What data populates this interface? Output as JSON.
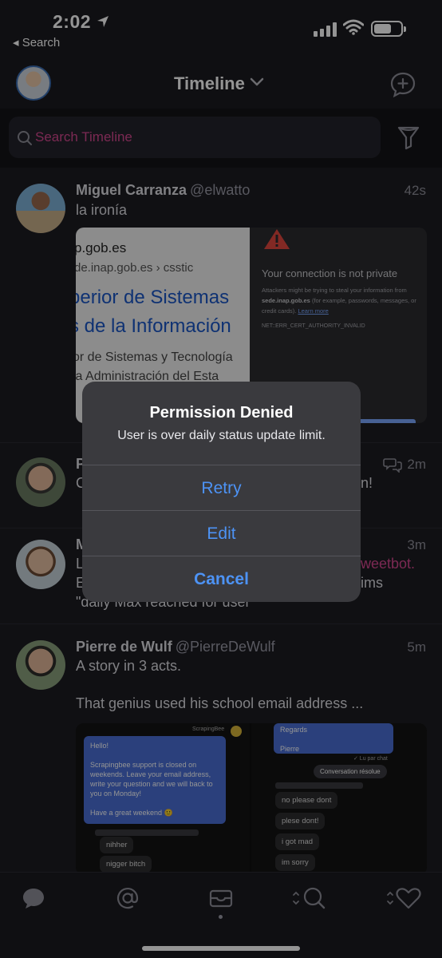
{
  "status_bar": {
    "time": "2:02",
    "back_label": "◂ Search",
    "battery_level": 0.65
  },
  "nav": {
    "title": "Timeline"
  },
  "search": {
    "placeholder": "Search Timeline"
  },
  "colors": {
    "accent_pink": "#d5488f",
    "alert_blue": "#4d93f5",
    "background": "#1c1c22"
  },
  "tweets": [
    {
      "name": "Miguel Carranza",
      "handle": "@elwatto",
      "time": "42s",
      "text": "la ironía",
      "media": {
        "left": {
          "line1": "p.gob.es",
          "line2": "de.inap.gob.es › csstic",
          "line3": "perior de Sistemas",
          "line4": "s de la Información",
          "line5": "or de Sistemas y Tecnología",
          "line6": "la Administración del Esta"
        },
        "right": {
          "title": "Your connection is not private",
          "body_prefix": "Attackers might be trying to steal your information from",
          "body_host": "sede.inap.gob.es",
          "body_suffix": "(for example, passwords, messages, or credit cards).",
          "learn_more": "Learn more",
          "error_code": "NET::ERR_CERT_AUTHORITY_INVALID"
        }
      }
    },
    {
      "name": "P",
      "handle": "",
      "time": "2m",
      "text_start": "C",
      "text_end": "n!"
    },
    {
      "name": "M",
      "handle": "",
      "time": "3m",
      "line1_start": "L",
      "line1_highlight": "weetbot.",
      "line2_start": "E",
      "line2_end": "ims",
      "line3": "\"daily Max reached for user\""
    },
    {
      "name": "Pierre de Wulf",
      "handle": "@PierreDeWulf",
      "time": "5m",
      "text1": "A story in 3 acts.",
      "text2": "That genius used his school email address ...",
      "media": {
        "brand": "ScrapingBee",
        "blue_msg": "Hello!\n\nScrapingbee support is closed on weekends. Leave your email address, write your question and we will back to you on Monday!\n\nHave a great weekend 🙂",
        "left_replies": [
          "nihher",
          "nigger bitch"
        ],
        "right_top": "Regards\n\nPierre",
        "right_tag": "✓ Lu par chat",
        "right_pill": "Conversation résolue",
        "right_replies": [
          "no please dont",
          "plese dont!",
          "i got mad",
          "im sorry"
        ]
      }
    }
  ],
  "alert": {
    "title": "Permission Denied",
    "message": "User is over daily status update limit.",
    "buttons": [
      "Retry",
      "Edit",
      "Cancel"
    ]
  }
}
